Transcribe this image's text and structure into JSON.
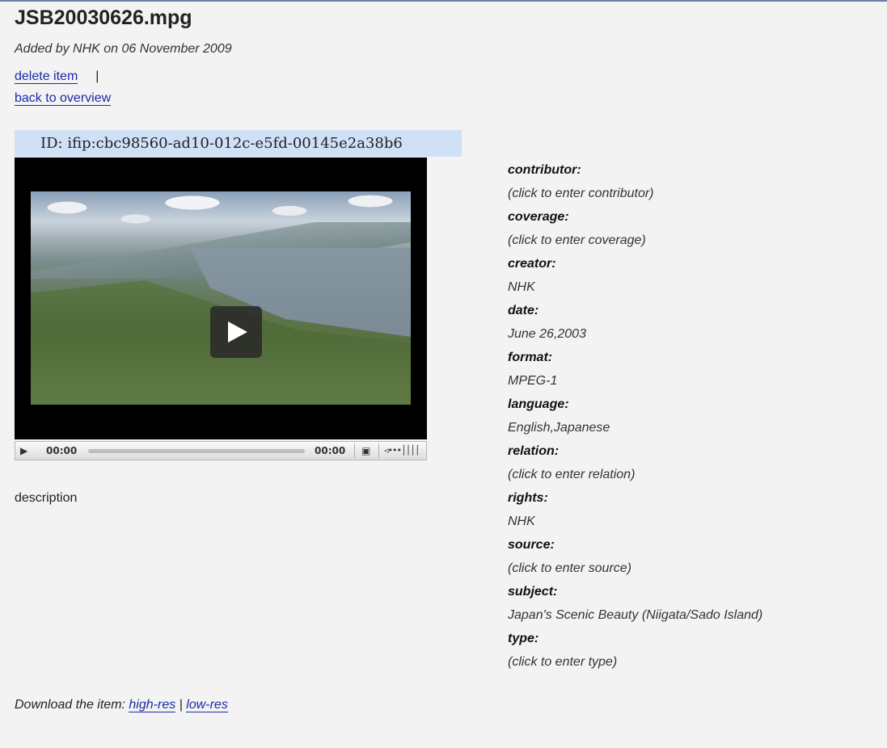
{
  "item": {
    "title": "JSB20030626.mpg",
    "added_by": "Added by NHK on 06 November 2009",
    "delete_label": "delete item",
    "separator": "|",
    "back_label": "back to overview",
    "id_text": "ID: ifip:cbc98560-ad10-012c-e5fd-00145e2a38b6"
  },
  "player": {
    "current_time": "00:00",
    "duration": "00:00",
    "progress": 0,
    "play_icon": "play-icon",
    "fullscreen_icon": "fullscreen-icon",
    "volume_icon": "volume-icon"
  },
  "description_label": "description",
  "metadata": [
    {
      "key": "contributor:",
      "value": "(click to enter contributor)"
    },
    {
      "key": "coverage:",
      "value": "(click to enter coverage)"
    },
    {
      "key": "creator:",
      "value": "NHK"
    },
    {
      "key": "date:",
      "value": "June 26,2003"
    },
    {
      "key": "format:",
      "value": "MPEG-1"
    },
    {
      "key": "language:",
      "value": "English,Japanese"
    },
    {
      "key": "relation:",
      "value": "(click to enter relation)"
    },
    {
      "key": "rights:",
      "value": "NHK"
    },
    {
      "key": "source:",
      "value": "(click to enter source)"
    },
    {
      "key": "subject:",
      "value": "Japan's Scenic Beauty (Niigata/Sado Island)"
    },
    {
      "key": "type:",
      "value": "(click to enter type)"
    }
  ],
  "download": {
    "prefix": "Download the item: ",
    "high_res": "high-res",
    "separator": " | ",
    "low_res": "low-res"
  }
}
